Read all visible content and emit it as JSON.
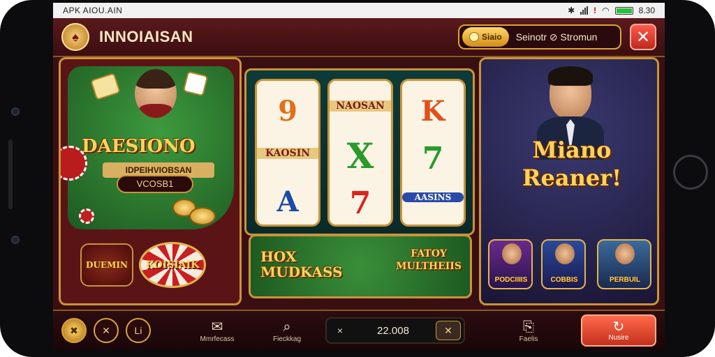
{
  "status": {
    "left": "APK  AIOU.AIN",
    "time": "8.30"
  },
  "header": {
    "brand": "INNOIAISAN",
    "coin_label": "Siaio",
    "account_name": "Seinotr ⊘ Stromun",
    "close_label": "✕"
  },
  "left_panel": {
    "title": "DAESIONO",
    "subtitle": "IDPEIHVIOBSAN",
    "code": "VCOSB1",
    "badge_left": "DUEMIN",
    "badge_right": "KOISIAIK"
  },
  "slot": {
    "reels": [
      [
        "9",
        "KAOSIN",
        "A"
      ],
      [
        "NAOSAN",
        "X",
        "7"
      ],
      [
        "K",
        "7",
        "AASINS"
      ]
    ],
    "bottom_left": "HOX MUDKASS",
    "bottom_right": "FATOY MULTHEIIS"
  },
  "right_panel": {
    "title_line1": "Miano",
    "title_line2": "Reaner!",
    "games": [
      "PODCIIIIS",
      "COBBIS",
      "PERBUIL"
    ]
  },
  "bottombar": {
    "btn1": "✖",
    "btn2": "✕",
    "btn3": "Li",
    "nav1": "Mmrfecass",
    "nav2": "Fieckkag",
    "nav3": "Faelis",
    "bet_prefix": "×",
    "bet_value": "22.008",
    "bet_action": "✕",
    "spin_label": "Nusire"
  },
  "colors": {
    "gold": "#c9943a",
    "felt": "#2f7a32",
    "accent_red": "#d8392a"
  }
}
